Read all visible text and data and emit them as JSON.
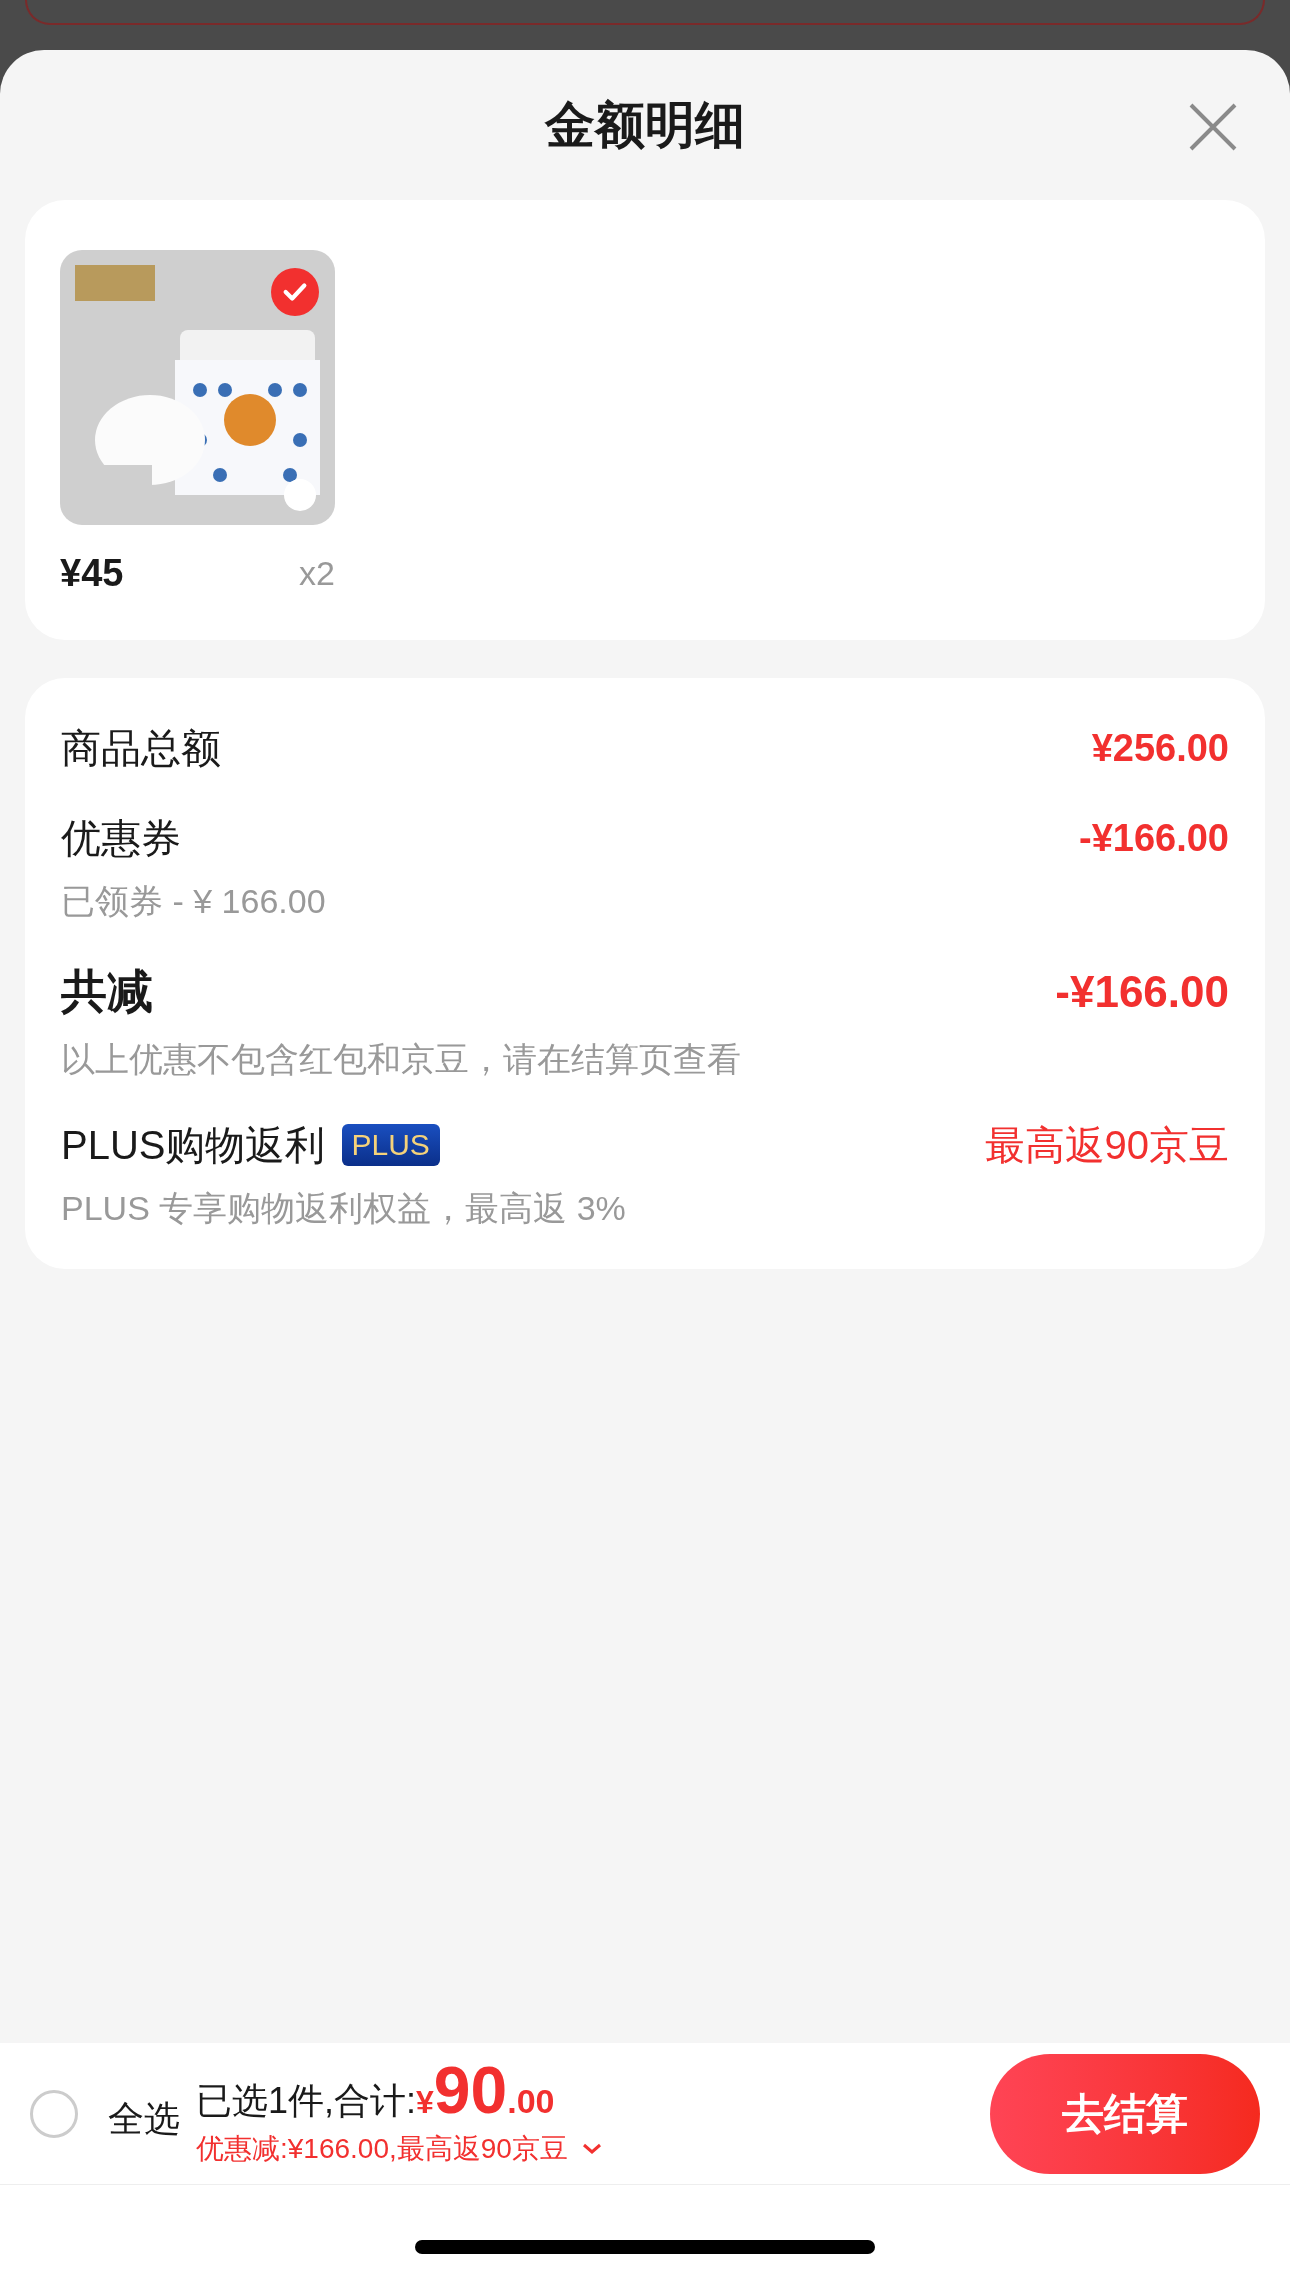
{
  "sheet": {
    "title": "金额明细"
  },
  "product": {
    "kind": "picture",
    "selected": true,
    "price": "¥45",
    "quantity": "x2"
  },
  "summary": [
    {
      "kind": "plain",
      "label": "商品总额",
      "value": "¥256.00"
    },
    {
      "kind": "plain",
      "label": "优惠券",
      "value": "-¥166.00",
      "note": "已领券 - ¥ 166.00"
    },
    {
      "kind": "total",
      "label": "共减",
      "value": "-¥166.00",
      "note": "以上优惠不包含红包和京豆，请在结算页查看"
    },
    {
      "kind": "plus",
      "label": "PLUS购物返利",
      "badge": "PLUS",
      "value": "最高返90京豆",
      "note": "PLUS 专享购物返利权益，最高返 3%"
    }
  ],
  "footer": {
    "select_all": {
      "label": "全选",
      "checked": false
    },
    "selected_text": "已选1件,合计:",
    "currency": "¥",
    "amount_int": "90",
    "amount_dec": ".00",
    "discount": "优惠减:¥166.00,最高返90京豆",
    "checkout": "去结算"
  }
}
